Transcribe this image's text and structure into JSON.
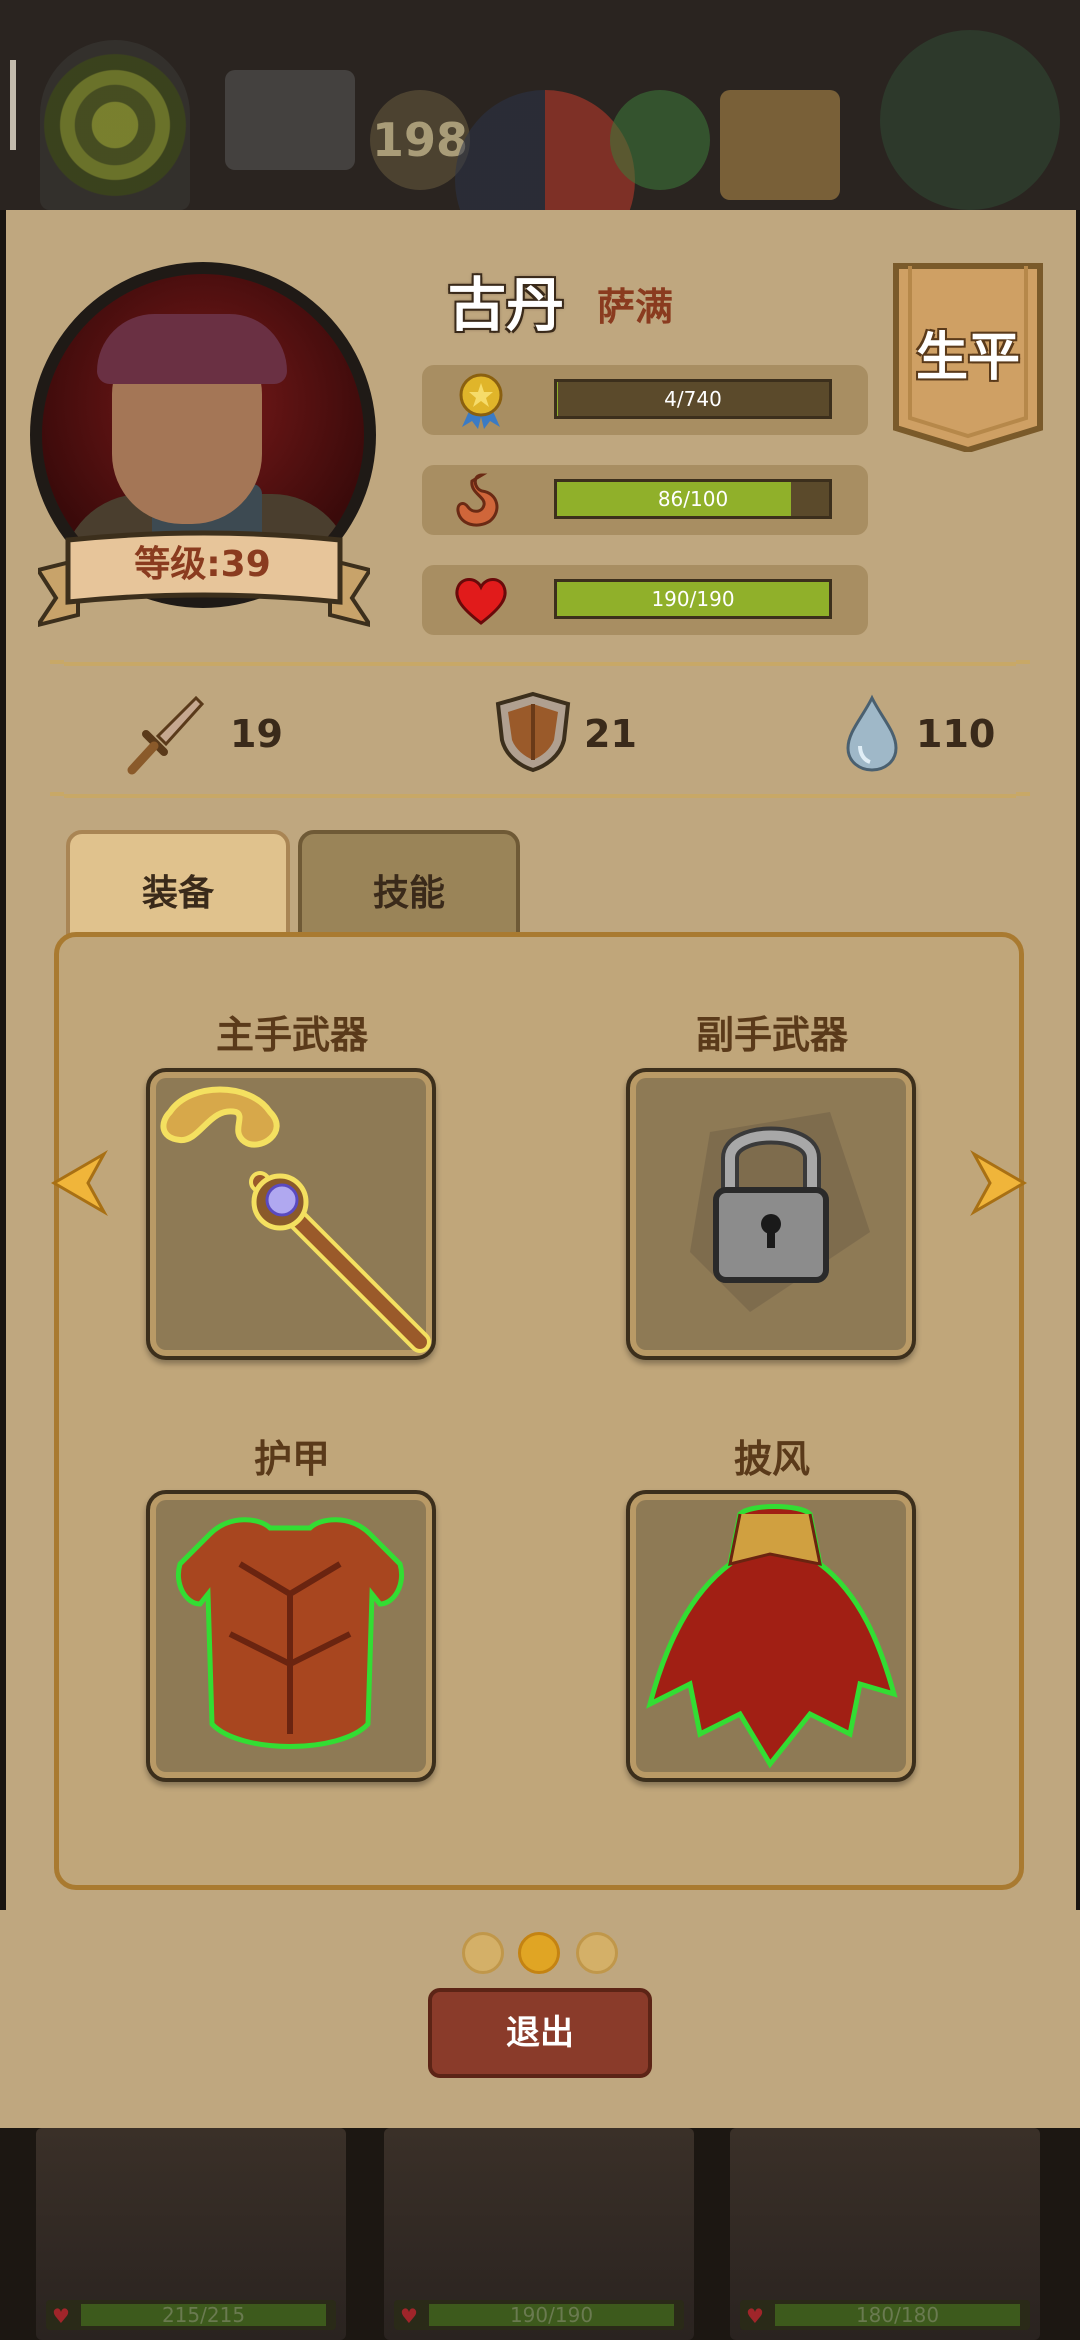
{
  "top": {
    "day_count": "198"
  },
  "hero": {
    "name": "古丹",
    "class": "萨满",
    "level_label": "等级:39",
    "biography_label": "生平"
  },
  "stats": {
    "experience": {
      "text": "4/740",
      "current": 4,
      "max": 740
    },
    "hunger": {
      "text": "86/100",
      "current": 86,
      "max": 100
    },
    "health": {
      "text": "190/190",
      "current": 190,
      "max": 190
    }
  },
  "attributes": {
    "attack": "19",
    "defense": "21",
    "mana": "110"
  },
  "tabs": {
    "equipment": "装备",
    "skills": "技能"
  },
  "equipment": {
    "main_hand": "主手武器",
    "off_hand": "副手武器",
    "armor": "护甲",
    "cloak": "披风"
  },
  "pagination": {
    "pages": 3,
    "active": 2
  },
  "exit_label": "退出",
  "party": [
    {
      "hp_text": "215/215"
    },
    {
      "hp_text": "190/190"
    },
    {
      "hp_text": "180/180"
    }
  ],
  "colors": {
    "panel": "#bfa77f",
    "bar_fill": "#90b02a",
    "accent": "#a97a30"
  }
}
